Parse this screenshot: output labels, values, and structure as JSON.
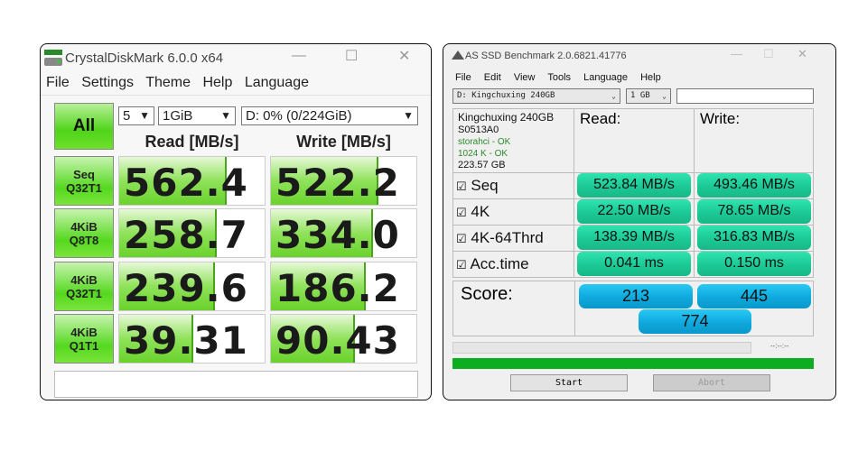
{
  "cdm": {
    "title": "CrystalDiskMark 6.0.0 x64",
    "menu": [
      "File",
      "Settings",
      "Theme",
      "Help",
      "Language"
    ],
    "all_label": "All",
    "count": "5",
    "size": "1GiB",
    "drive": "D: 0% (0/224GiB)",
    "read_header": "Read [MB/s]",
    "write_header": "Write [MB/s]",
    "rows": [
      {
        "l1": "Seq",
        "l2": "Q32T1",
        "read": "562.4",
        "write": "522.2",
        "read_fill": 0.74,
        "write_fill": 0.74
      },
      {
        "l1": "4KiB",
        "l2": "Q8T8",
        "read": "258.7",
        "write": "334.0",
        "read_fill": 0.67,
        "write_fill": 0.7
      },
      {
        "l1": "4KiB",
        "l2": "Q32T1",
        "read": "239.6",
        "write": "186.2",
        "read_fill": 0.66,
        "write_fill": 0.65
      },
      {
        "l1": "4KiB",
        "l2": "Q1T1",
        "read": "39.31",
        "write": "90.43",
        "read_fill": 0.51,
        "write_fill": 0.58
      }
    ],
    "comment": ""
  },
  "asd": {
    "title": "AS SSD Benchmark 2.0.6821.41776",
    "menu": [
      "File",
      "Edit",
      "View",
      "Tools",
      "Language",
      "Help"
    ],
    "drive": "D: Kingchuxing 240GB",
    "size": "1 GB",
    "text": "",
    "info": {
      "name": "Kingchuxing 240GB",
      "fw": "S0513A0",
      "driver": "storahci - OK",
      "align": "1024 K - OK",
      "capacity": "223.57 GB"
    },
    "read_header": "Read:",
    "write_header": "Write:",
    "rows": [
      {
        "label": "Seq",
        "read": "523.84 MB/s",
        "write": "493.46 MB/s"
      },
      {
        "label": "4K",
        "read": "22.50 MB/s",
        "write": "78.65 MB/s"
      },
      {
        "label": "4K-64Thrd",
        "read": "138.39 MB/s",
        "write": "316.83 MB/s"
      },
      {
        "label": "Acc.time",
        "read": "0.041 ms",
        "write": "0.150 ms"
      }
    ],
    "checkbox": "☑",
    "score_label": "Score:",
    "score_read": "213",
    "score_write": "445",
    "score_total": "774",
    "time": "--:--:--",
    "progress": 1.0,
    "start": "Start",
    "abort": "Abort"
  }
}
